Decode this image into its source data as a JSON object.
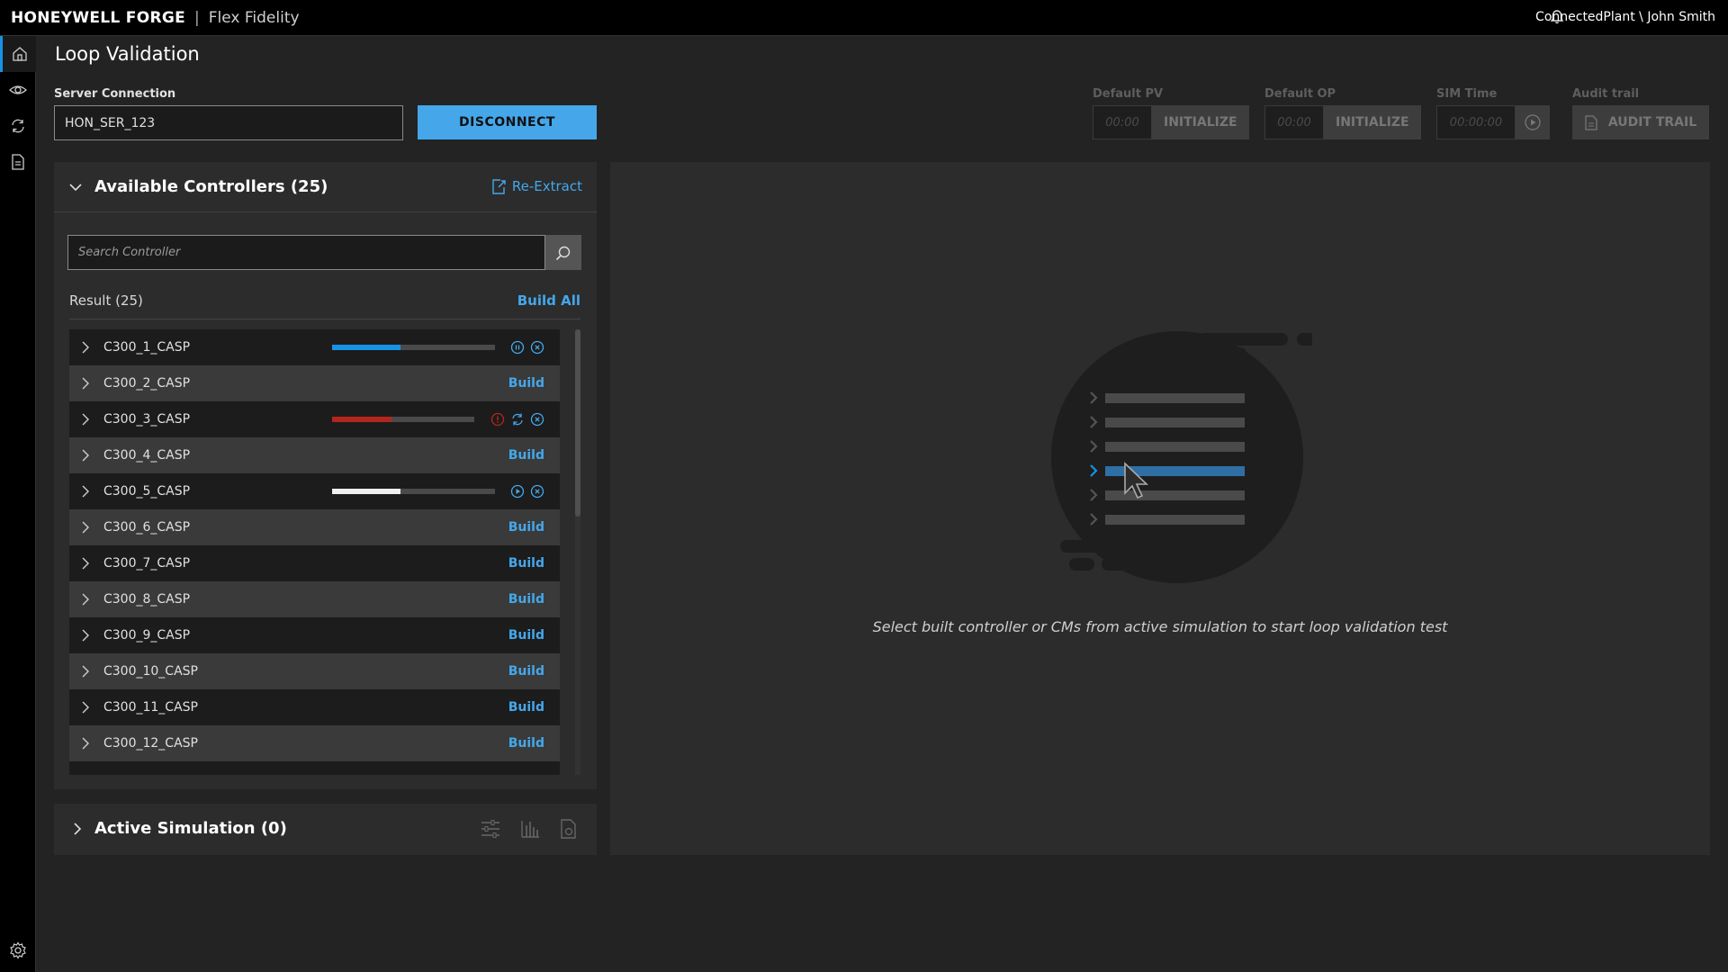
{
  "header": {
    "brand": "HONEYWELL FORGE",
    "separator": "|",
    "product": "Flex Fidelity",
    "user": "ConnectedPlant \\ John Smith"
  },
  "page": {
    "title": "Loop Validation"
  },
  "server": {
    "label": "Server Connection",
    "value": "HON_SER_123",
    "disconnect_label": "DISCONNECT"
  },
  "controls": {
    "default_pv": {
      "label": "Default PV",
      "time": "00:00",
      "button": "INITIALIZE"
    },
    "default_op": {
      "label": "Default OP",
      "time": "00:00",
      "button": "INITIALIZE"
    },
    "sim_time": {
      "label": "SIM Time",
      "time": "00:00:00"
    },
    "audit": {
      "label": "Audit trail",
      "button": "AUDIT TRAIL"
    }
  },
  "available": {
    "title": "Available Controllers (25)",
    "reextract": "Re-Extract",
    "search_placeholder": "Search Controller",
    "result_label": "Result (25)",
    "build_all": "Build All",
    "build_label": "Build",
    "items": [
      {
        "name": "C300_1_CASP",
        "state": "running",
        "progress": 0.42,
        "color": "#1792e5"
      },
      {
        "name": "C300_2_CASP",
        "state": "idle"
      },
      {
        "name": "C300_3_CASP",
        "state": "error",
        "progress": 0.42,
        "color": "#b3261e"
      },
      {
        "name": "C300_4_CASP",
        "state": "idle"
      },
      {
        "name": "C300_5_CASP",
        "state": "paused",
        "progress": 0.42,
        "color": "#f0f0f0"
      },
      {
        "name": "C300_6_CASP",
        "state": "idle"
      },
      {
        "name": "C300_7_CASP",
        "state": "idle"
      },
      {
        "name": "C300_8_CASP",
        "state": "idle"
      },
      {
        "name": "C300_9_CASP",
        "state": "idle"
      },
      {
        "name": "C300_10_CASP",
        "state": "idle"
      },
      {
        "name": "C300_11_CASP",
        "state": "idle"
      },
      {
        "name": "C300_12_CASP",
        "state": "idle"
      }
    ]
  },
  "active_simulation": {
    "title": "Active Simulation (0)"
  },
  "main": {
    "empty_message": "Select built controller or CMs from active simulation to start loop validation test"
  },
  "colors": {
    "accent": "#45a7ea",
    "error": "#b3261e",
    "background": "#232323"
  }
}
